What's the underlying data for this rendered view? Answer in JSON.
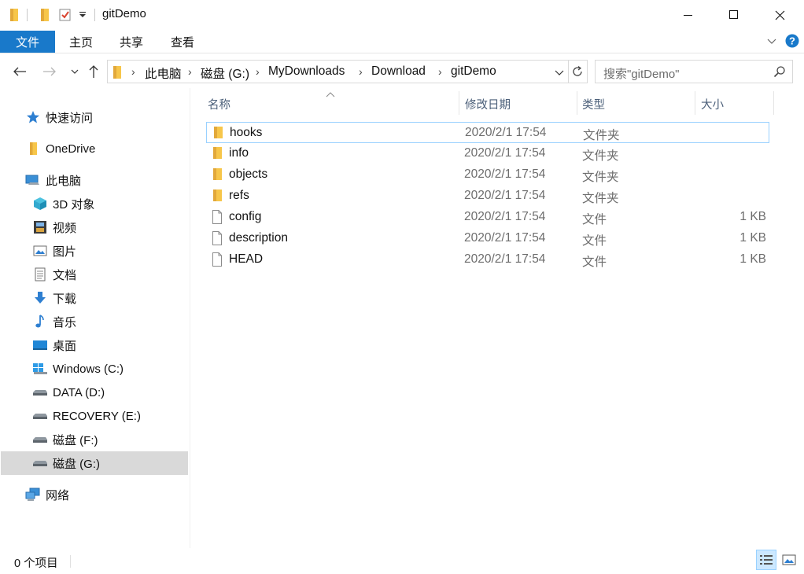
{
  "window": {
    "title": "gitDemo"
  },
  "ribbon": {
    "tabs": [
      "文件",
      "主页",
      "共享",
      "查看"
    ]
  },
  "address": {
    "crumbs": [
      "此电脑",
      "磁盘 (G:)",
      "MyDownloads",
      "Download",
      "gitDemo"
    ]
  },
  "search": {
    "placeholder": "搜索\"gitDemo\""
  },
  "nav": {
    "quick_access": "快速访问",
    "onedrive": "OneDrive",
    "this_pc": "此电脑",
    "objects3d": "3D 对象",
    "videos": "视频",
    "pictures": "图片",
    "documents": "文档",
    "downloads": "下载",
    "music": "音乐",
    "desktop": "桌面",
    "drive_c": "Windows (C:)",
    "drive_d": "DATA (D:)",
    "drive_e": "RECOVERY (E:)",
    "drive_f": "磁盘 (F:)",
    "drive_g": "磁盘 (G:)",
    "network": "网络"
  },
  "columns": {
    "name": "名称",
    "date": "修改日期",
    "type": "类型",
    "size": "大小"
  },
  "files": [
    {
      "name": "hooks",
      "date": "2020/2/1 17:54",
      "type": "文件夹",
      "size": "",
      "kind": "folder"
    },
    {
      "name": "info",
      "date": "2020/2/1 17:54",
      "type": "文件夹",
      "size": "",
      "kind": "folder"
    },
    {
      "name": "objects",
      "date": "2020/2/1 17:54",
      "type": "文件夹",
      "size": "",
      "kind": "folder"
    },
    {
      "name": "refs",
      "date": "2020/2/1 17:54",
      "type": "文件夹",
      "size": "",
      "kind": "folder"
    },
    {
      "name": "config",
      "date": "2020/2/1 17:54",
      "type": "文件",
      "size": "1 KB",
      "kind": "file"
    },
    {
      "name": "description",
      "date": "2020/2/1 17:54",
      "type": "文件",
      "size": "1 KB",
      "kind": "file"
    },
    {
      "name": "HEAD",
      "date": "2020/2/1 17:54",
      "type": "文件",
      "size": "1 KB",
      "kind": "file"
    }
  ],
  "status": {
    "item_count": "0 个项目"
  },
  "colors": {
    "accent": "#1979ca",
    "folder": "#f7c64a",
    "selection": "#d9d9d9",
    "focus_border": "#99d1ff"
  }
}
